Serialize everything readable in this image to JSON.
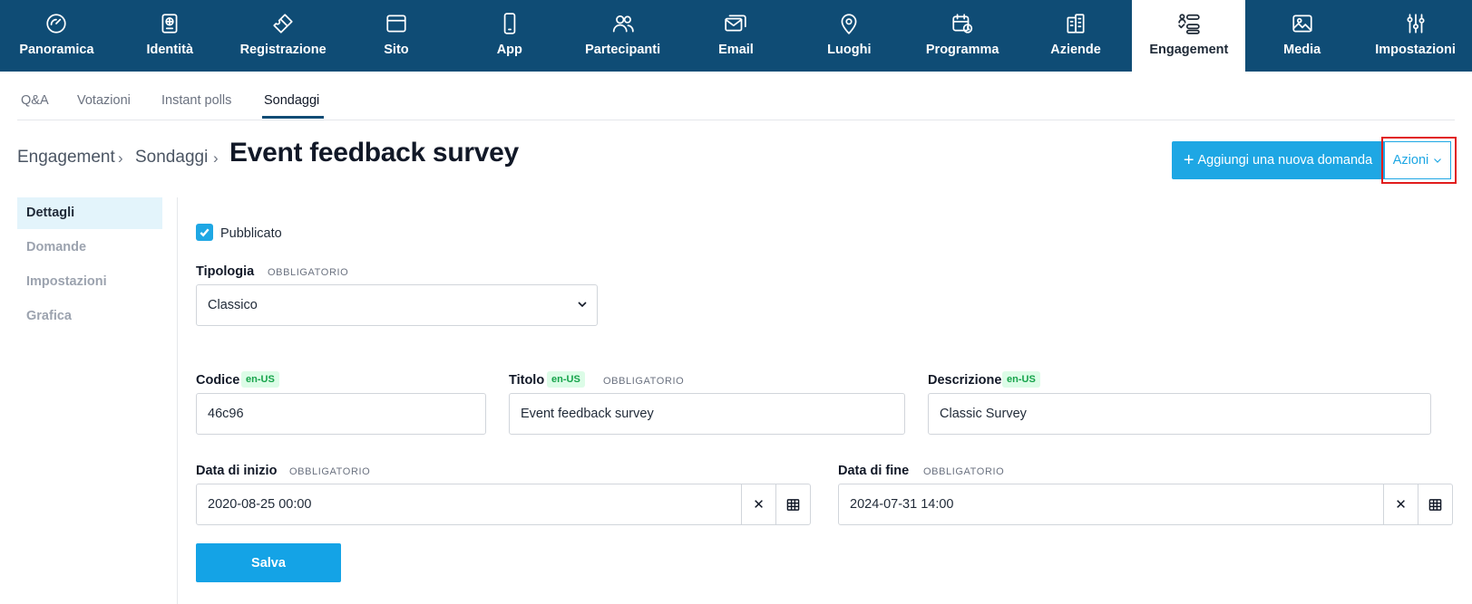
{
  "nav": {
    "items": [
      {
        "label": "Panoramica",
        "icon": "dashboard-icon"
      },
      {
        "label": "Identità",
        "icon": "passport-icon"
      },
      {
        "label": "Registrazione",
        "icon": "ticket-icon"
      },
      {
        "label": "Sito",
        "icon": "browser-window-icon"
      },
      {
        "label": "App",
        "icon": "mobile-phone-icon"
      },
      {
        "label": "Partecipanti",
        "icon": "users-icon"
      },
      {
        "label": "Email",
        "icon": "email-icon"
      },
      {
        "label": "Luoghi",
        "icon": "map-pin-icon"
      },
      {
        "label": "Programma",
        "icon": "calendar-clock-icon"
      },
      {
        "label": "Aziende",
        "icon": "buildings-icon"
      },
      {
        "label": "Engagement",
        "icon": "engagement-list-icon"
      },
      {
        "label": "Media",
        "icon": "image-icon"
      },
      {
        "label": "Impostazioni",
        "icon": "sliders-icon"
      }
    ],
    "active": "Engagement"
  },
  "subtabs": [
    "Q&A",
    "Votazioni",
    "Instant polls",
    "Sondaggi"
  ],
  "subtabs_active": "Sondaggi",
  "breadcrumb": {
    "root": "Engagement",
    "section": "Sondaggi",
    "separator": "›",
    "title": "Event feedback survey"
  },
  "actions": {
    "add_question": "Aggiungi una nuova domanda",
    "add_icon": "+",
    "menu": "Azioni",
    "menu_icon": "chevron-down-icon"
  },
  "sidebar": {
    "items": [
      "Dettagli",
      "Domande",
      "Impostazioni",
      "Grafica"
    ],
    "active": "Dettagli"
  },
  "form": {
    "published_label": "Pubblicato",
    "published_checked": true,
    "required_text": "OBBLIGATORIO",
    "lang_badge": "en-US",
    "tipologia": {
      "label": "Tipologia",
      "value": "Classico"
    },
    "codice": {
      "label": "Codice",
      "value": "46c96"
    },
    "titolo": {
      "label": "Titolo",
      "value": "Event feedback survey"
    },
    "descrizione": {
      "label": "Descrizione",
      "value": "Classic Survey"
    },
    "data_inizio": {
      "label": "Data di inizio",
      "value": "2020-08-25 00:00"
    },
    "data_fine": {
      "label": "Data di fine",
      "value": "2024-07-31 14:00"
    },
    "clear_icon": "✕",
    "save": "Salva"
  },
  "colors": {
    "nav_bg": "#0f4c75",
    "accent": "#1ea7e4",
    "highlight": "#e11d1d",
    "badge_bg": "#dcfce7",
    "badge_text": "#16a34a"
  }
}
